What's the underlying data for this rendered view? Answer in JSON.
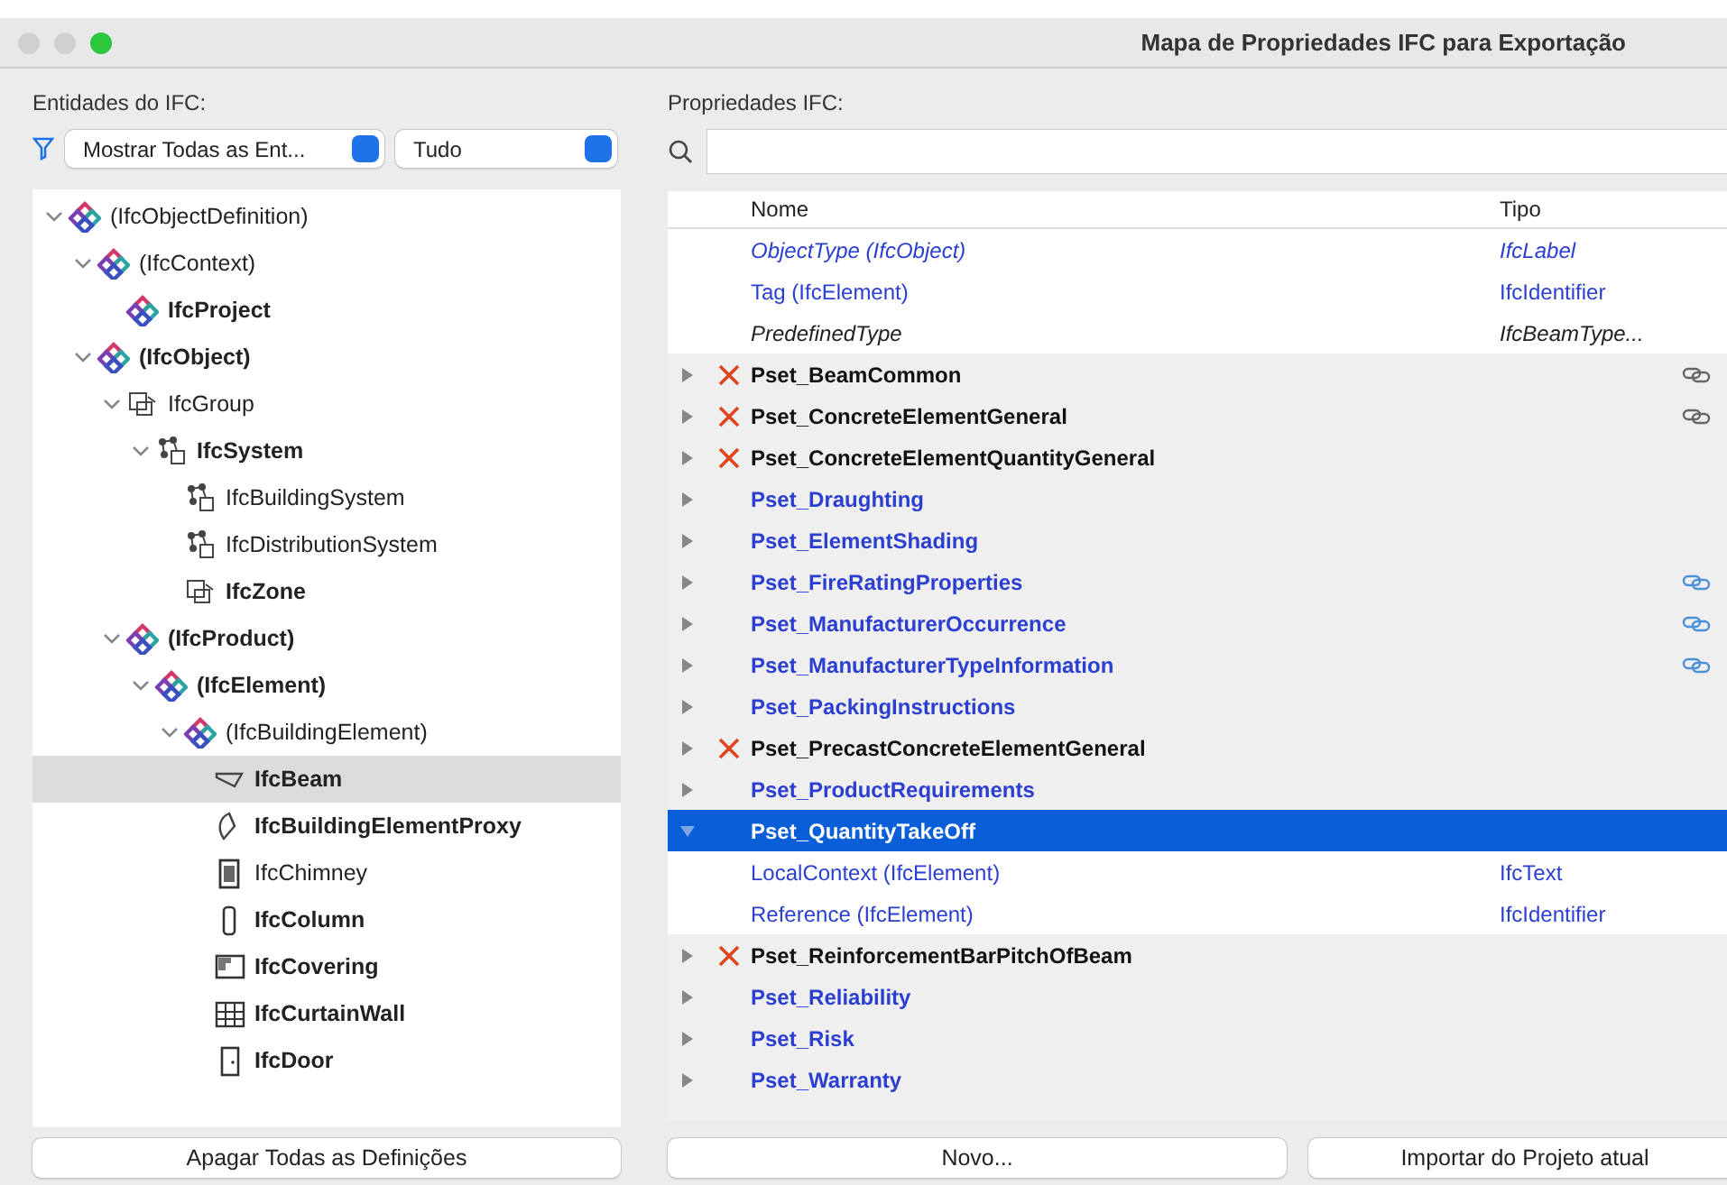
{
  "window": {
    "title": "Mapa de Propriedades IFC para Exportação"
  },
  "left": {
    "label": "Entidades do IFC:",
    "filter": "Mostrar Todas as Ent...",
    "scope": "Tudo",
    "tree": [
      {
        "label": "(IfcObjectDefinition)",
        "kind": "ifc",
        "bold": false,
        "expanded": true,
        "selected": false,
        "children": [
          {
            "label": "(IfcContext)",
            "kind": "ifc",
            "bold": false,
            "expanded": true,
            "selected": false,
            "children": [
              {
                "label": "IfcProject",
                "kind": "ifc",
                "bold": true,
                "selected": false
              }
            ]
          },
          {
            "label": "(IfcObject)",
            "kind": "ifc",
            "bold": true,
            "expanded": true,
            "selected": false,
            "children": [
              {
                "label": "IfcGroup",
                "kind": "group",
                "bold": false,
                "expanded": true,
                "selected": false,
                "children": [
                  {
                    "label": "IfcSystem",
                    "kind": "system",
                    "bold": true,
                    "expanded": true,
                    "selected": false,
                    "children": [
                      {
                        "label": "IfcBuildingSystem",
                        "kind": "system",
                        "bold": false,
                        "selected": false
                      },
                      {
                        "label": "IfcDistributionSystem",
                        "kind": "system",
                        "bold": false,
                        "selected": false
                      },
                      {
                        "label": "IfcZone",
                        "kind": "group",
                        "bold": true,
                        "selected": false
                      }
                    ]
                  }
                ]
              },
              {
                "label": "(IfcProduct)",
                "kind": "ifc",
                "bold": true,
                "expanded": true,
                "selected": false,
                "children": [
                  {
                    "label": "(IfcElement)",
                    "kind": "ifc",
                    "bold": true,
                    "expanded": true,
                    "selected": false,
                    "children": [
                      {
                        "label": "(IfcBuildingElement)",
                        "kind": "ifc",
                        "bold": false,
                        "expanded": true,
                        "selected": false,
                        "children": [
                          {
                            "label": "IfcBeam",
                            "kind": "beam",
                            "bold": true,
                            "selected": true
                          },
                          {
                            "label": "IfcBuildingElementProxy",
                            "kind": "proxy",
                            "bold": true,
                            "selected": false
                          },
                          {
                            "label": "IfcChimney",
                            "kind": "chimney",
                            "bold": false,
                            "selected": false
                          },
                          {
                            "label": "IfcColumn",
                            "kind": "column",
                            "bold": true,
                            "selected": false
                          },
                          {
                            "label": "IfcCovering",
                            "kind": "covering",
                            "bold": true,
                            "selected": false
                          },
                          {
                            "label": "IfcCurtainWall",
                            "kind": "curtain",
                            "bold": true,
                            "selected": false
                          },
                          {
                            "label": "IfcDoor",
                            "kind": "door",
                            "bold": true,
                            "selected": false
                          }
                        ]
                      }
                    ]
                  }
                ]
              }
            ]
          }
        ]
      }
    ],
    "button": "Apagar Todas as Definições"
  },
  "right": {
    "label": "Propriedades IFC:",
    "columns": [
      "Nome",
      "Tipo"
    ],
    "rows": [
      {
        "kind": "property",
        "name": "ObjectType (IfcObject)",
        "type": "IfcLabel",
        "blue": true,
        "italic": true
      },
      {
        "kind": "property",
        "name": "Tag (IfcElement)",
        "type": "IfcIdentifier",
        "blue": true,
        "italic": false
      },
      {
        "kind": "property",
        "name": "PredefinedType",
        "type": "IfcBeamType...",
        "blue": false,
        "italic": true
      },
      {
        "kind": "pset",
        "name": "Pset_BeamCommon",
        "blue": false,
        "invalid": true,
        "expanded": false,
        "selected": false,
        "color": "#666666"
      },
      {
        "kind": "pset",
        "name": "Pset_ConcreteElementGeneral",
        "blue": false,
        "invalid": true,
        "expanded": false,
        "selected": false,
        "color": "#666666"
      },
      {
        "kind": "pset",
        "name": "Pset_ConcreteElementQuantityGeneral",
        "blue": false,
        "invalid": true,
        "expanded": false,
        "selected": false
      },
      {
        "kind": "pset",
        "name": "Pset_Draughting",
        "blue": true,
        "invalid": false,
        "expanded": false,
        "selected": false
      },
      {
        "kind": "pset",
        "name": "Pset_ElementShading",
        "blue": true,
        "invalid": false,
        "expanded": false,
        "selected": false
      },
      {
        "kind": "pset",
        "name": "Pset_FireRatingProperties",
        "blue": true,
        "invalid": false,
        "expanded": false,
        "selected": false,
        "color": "#4a8fd8"
      },
      {
        "kind": "pset",
        "name": "Pset_ManufacturerOccurrence",
        "blue": true,
        "invalid": false,
        "expanded": false,
        "selected": false,
        "color": "#4a8fd8"
      },
      {
        "kind": "pset",
        "name": "Pset_ManufacturerTypeInformation",
        "blue": true,
        "invalid": false,
        "expanded": false,
        "selected": false,
        "color": "#4a8fd8"
      },
      {
        "kind": "pset",
        "name": "Pset_PackingInstructions",
        "blue": true,
        "invalid": false,
        "expanded": false,
        "selected": false
      },
      {
        "kind": "pset",
        "name": "Pset_PrecastConcreteElementGeneral",
        "blue": false,
        "invalid": true,
        "expanded": false,
        "selected": false
      },
      {
        "kind": "pset",
        "name": "Pset_ProductRequirements",
        "blue": true,
        "invalid": false,
        "expanded": false,
        "selected": false
      },
      {
        "kind": "pset",
        "name": "Pset_QuantityTakeOff",
        "invalid": false,
        "expanded": true,
        "selected": true
      },
      {
        "kind": "property",
        "name": "LocalContext (IfcElement)",
        "type": "IfcText",
        "blue": true,
        "italic": false
      },
      {
        "kind": "property",
        "name": "Reference (IfcElement)",
        "type": "IfcIdentifier",
        "blue": true,
        "italic": false
      },
      {
        "kind": "pset",
        "name": "Pset_ReinforcementBarPitchOfBeam",
        "blue": false,
        "invalid": true,
        "expanded": false,
        "selected": false
      },
      {
        "kind": "pset",
        "name": "Pset_Reliability",
        "blue": true,
        "invalid": false,
        "expanded": false,
        "selected": false
      },
      {
        "kind": "pset",
        "name": "Pset_Risk",
        "blue": true,
        "invalid": false,
        "expanded": false,
        "selected": false
      },
      {
        "kind": "pset",
        "name": "Pset_Warranty",
        "blue": true,
        "invalid": false,
        "expanded": false,
        "selected": false
      }
    ],
    "buttons": [
      "Novo...",
      "Importar do Projeto atual"
    ]
  }
}
